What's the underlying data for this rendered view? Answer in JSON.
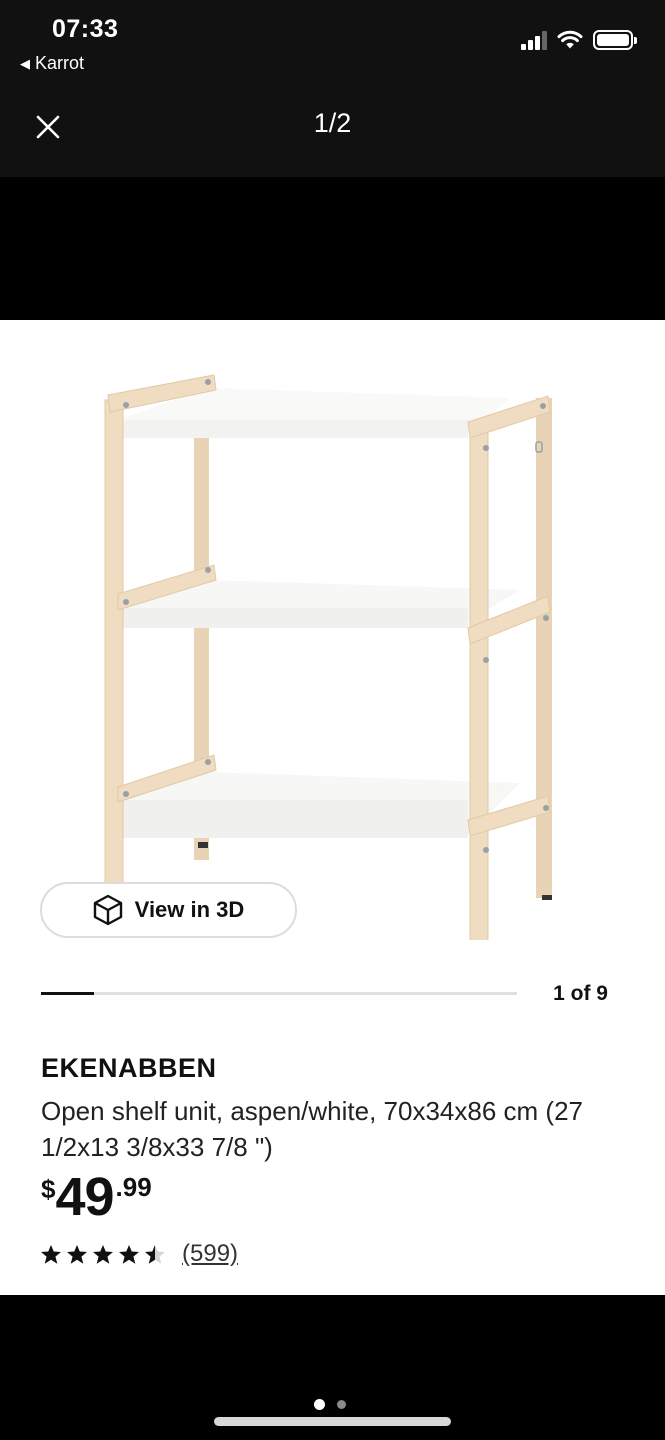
{
  "status_bar": {
    "time": "07:33",
    "back_app": "Karrot",
    "back_glyph": "◀"
  },
  "viewer": {
    "counter": "1/2",
    "close_icon": "close-icon"
  },
  "product": {
    "view3d_label": "View in 3D",
    "image_position": "1 of 9",
    "image_progress_fraction": 0.111,
    "name": "EKENABBEN",
    "description": "Open shelf unit, aspen/white, 70x34x86 cm (27 1/2x13 3/8x33 7/8 \")",
    "price": {
      "currency": "$",
      "integer": "49",
      "cents": ".99"
    },
    "rating": {
      "stars": 4.5,
      "out_of": 5,
      "reviews": "(599)"
    }
  },
  "pager": {
    "count": 2,
    "active": 0
  },
  "colors": {
    "header_bg": "#111111",
    "card_bg": "#ffffff",
    "wood": "#efdcc1",
    "shelf": "#f8f8f6"
  }
}
